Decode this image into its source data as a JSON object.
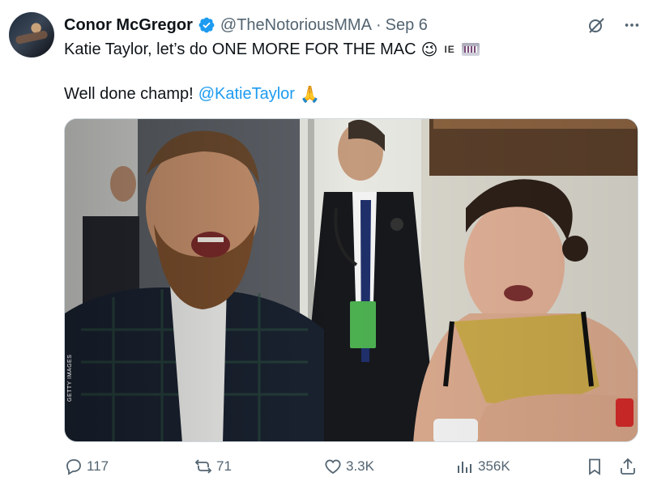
{
  "author": {
    "name": "Conor McGregor",
    "handle": "@TheNotoriousMMA",
    "separator": "·",
    "date": "Sep 6",
    "avatar_icon": "profile-photo",
    "verified_color": "#1d9bf0"
  },
  "tweet": {
    "line1_text": "Katie Taylor, let’s do ONE MORE FOR THE MAC",
    "line1_emoji": "😉",
    "line1_flag_code": "IE",
    "line2_text": "Well done champ!",
    "mention": "@KatieTaylor",
    "line2_emoji": "🙏"
  },
  "media": {
    "credit": "GETTY IMAGES"
  },
  "actions": {
    "replies": "117",
    "reposts": "71",
    "likes": "3.3K",
    "views": "356K"
  },
  "icons": {
    "top": [
      "grok-icon",
      "more-icon"
    ],
    "bottom": [
      "reply-icon",
      "repost-icon",
      "like-icon",
      "views-icon",
      "bookmark-icon",
      "share-icon"
    ]
  },
  "colors": {
    "accent": "#1d9bf0",
    "secondary_text": "#536471",
    "primary_text": "#0f1419"
  }
}
